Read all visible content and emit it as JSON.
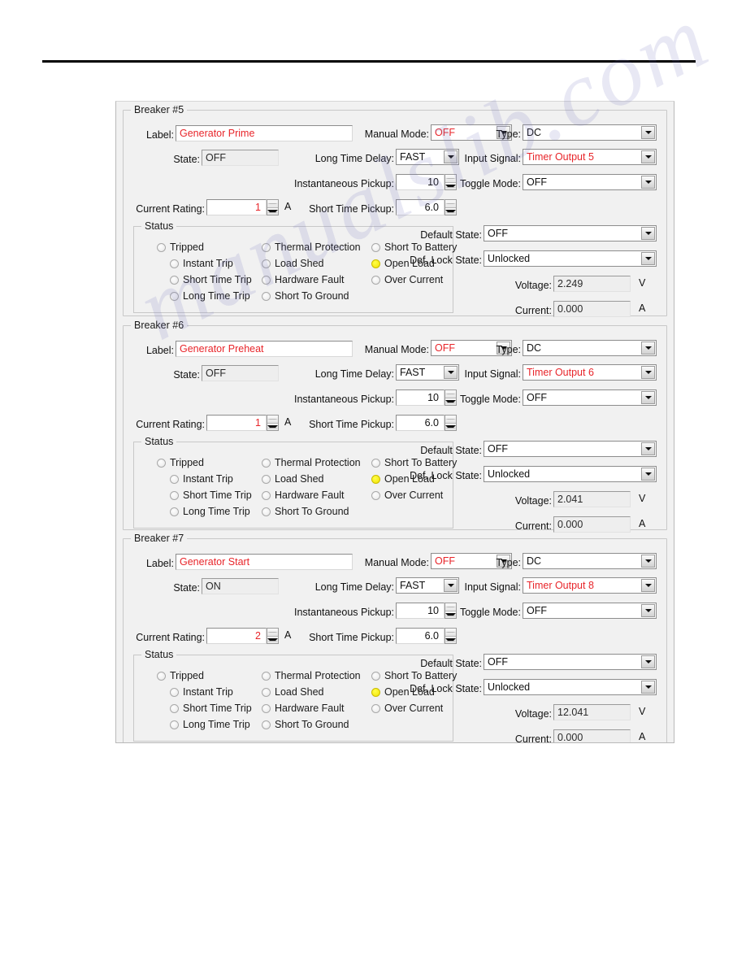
{
  "page": {
    "rule": "horizontal-rule"
  },
  "watermark": {
    "text": "manualslib.com"
  },
  "status_labels": {
    "group_title": "Status",
    "col1": [
      "Tripped",
      "Instant Trip",
      "Short Time Trip",
      "Long Time Trip"
    ],
    "col2": [
      "Thermal Protection",
      "Load Shed",
      "Hardware Fault",
      "Short To Ground"
    ],
    "col3": [
      "Short To Battery",
      "Open Load",
      "Over Current"
    ]
  },
  "field_labels": {
    "label": "Label:",
    "state": "State:",
    "current_rating": "Current Rating:",
    "manual_mode": "Manual Mode:",
    "long_time_delay": "Long Time Delay:",
    "instantaneous_pickup": "Instantaneous Pickup:",
    "short_time_pickup": "Short Time Pickup:",
    "type": "Type:",
    "input_signal": "Input Signal:",
    "toggle_mode": "Toggle Mode:",
    "default_state": "Default State:",
    "def_lock_state": "Def. Lock State:",
    "voltage": "Voltage:",
    "current": "Current:",
    "unit_amp": "A",
    "unit_volt": "V"
  },
  "colors": {
    "accent_red": "#e8252a",
    "indicator_on": "#ffee00",
    "dialog_bg": "#f1f1f1"
  },
  "breakers": [
    {
      "title": "Breaker #5",
      "label": "Generator Prime",
      "state": "OFF",
      "current_rating": "1",
      "manual_mode": "OFF",
      "long_time_delay": "FAST",
      "instantaneous_pickup": "10",
      "short_time_pickup": "6.0",
      "type": "DC",
      "input_signal": "Timer Output 5",
      "toggle_mode": "OFF",
      "default_state": "OFF",
      "def_lock_state": "Unlocked",
      "voltage": "2.249",
      "current": "0.000",
      "status_on": [
        "Open Load"
      ]
    },
    {
      "title": "Breaker #6",
      "label": "Generator Preheat",
      "state": "OFF",
      "current_rating": "1",
      "manual_mode": "OFF",
      "long_time_delay": "FAST",
      "instantaneous_pickup": "10",
      "short_time_pickup": "6.0",
      "type": "DC",
      "input_signal": "Timer Output 6",
      "toggle_mode": "OFF",
      "default_state": "OFF",
      "def_lock_state": "Unlocked",
      "voltage": "2.041",
      "current": "0.000",
      "status_on": [
        "Open Load"
      ]
    },
    {
      "title": "Breaker #7",
      "label": "Generator Start",
      "state": "ON",
      "current_rating": "2",
      "manual_mode": "OFF",
      "long_time_delay": "FAST",
      "instantaneous_pickup": "10",
      "short_time_pickup": "6.0",
      "type": "DC",
      "input_signal": "Timer Output 8",
      "toggle_mode": "OFF",
      "default_state": "OFF",
      "def_lock_state": "Unlocked",
      "voltage": "12.041",
      "current": "0.000",
      "status_on": [
        "Open Load"
      ]
    }
  ]
}
